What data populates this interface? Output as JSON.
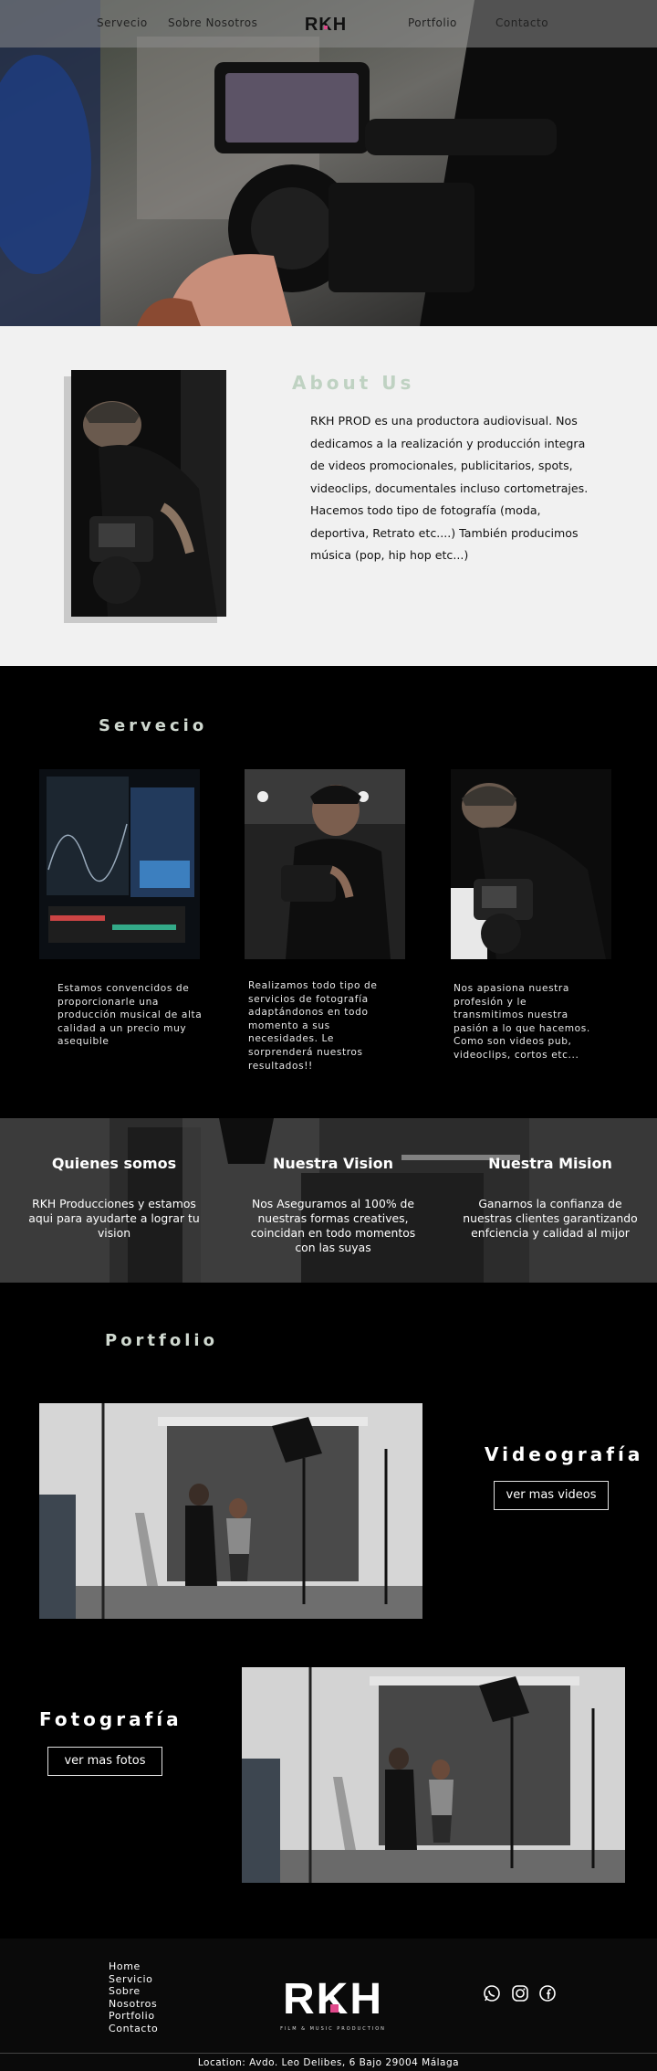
{
  "nav": {
    "items": [
      "Servecio",
      "Sobre Nosotros",
      "Portfolio",
      "Contacto"
    ],
    "logo_text": "RKH"
  },
  "about": {
    "title": "About Us",
    "text": "RKH PROD es una productora audiovisual. Nos dedicamos a la realización y producción integra de videos promocionales, publicitarios, spots, videoclips, documentales incluso cortometrajes. Hacemos todo tipo de fotografía (moda, deportiva, Retrato etc....) También producimos música (pop, hip hop etc...)"
  },
  "servicio": {
    "title": "Servecio",
    "cards": [
      {
        "text": "Estamos convencidos de proporcionarle una producción musical de alta calidad a un precio muy asequible"
      },
      {
        "text": "Realizamos todo tipo de servicios de fotografía adaptándonos en todo momento a sus necesidades. Le sorprenderá nuestros resultados!!"
      },
      {
        "text": "Nos apasiona nuestra profesión y le transmitimos nuestra pasión a lo que hacemos. Como son videos pub, videoclips, cortos etc..."
      }
    ]
  },
  "band": {
    "columns": [
      {
        "title": "Quienes somos",
        "text": "RKH Producciones y estamos aqui para ayudarte a lograr tu vision"
      },
      {
        "title": "Nuestra Vision",
        "text": "Nos Aseguramos al 100% de nuestras formas creatives, coincidan en todo momentos con las suyas"
      },
      {
        "title": "Nuestra Mision",
        "text": "Ganarnos la confianza de nuestras clientes garantizando enfciencia y calidad al mijor"
      }
    ]
  },
  "portfolio": {
    "title": "Portfolio",
    "video_heading": "Videografía",
    "video_button": "ver mas videos",
    "photo_heading": "Fotografía",
    "photo_button": "ver mas fotos"
  },
  "footer": {
    "links": [
      "Home",
      "Servicio",
      "Sobre",
      "Nosotros",
      "Portfolio",
      "Contacto"
    ],
    "logo_text": "RKH",
    "logo_subtitle": "FILM & MUSIC PRODUCTION",
    "social_icons": [
      "whatsapp-icon",
      "instagram-icon",
      "facebook-icon"
    ],
    "location": "Location: Avdo. Leo Delibes, 6 Bajo 29004 Málaga"
  },
  "colors": {
    "accent_green": "#bfd2c2",
    "logo_pink": "#e0488a",
    "about_bg": "#f1f1f1"
  }
}
